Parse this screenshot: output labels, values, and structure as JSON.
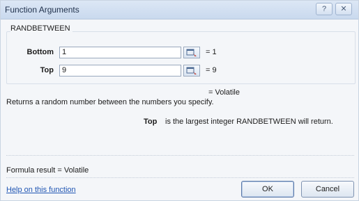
{
  "dialog": {
    "title": "Function Arguments",
    "help_button": "?",
    "close_button": "✕"
  },
  "function_name": "RANDBETWEEN",
  "arguments": [
    {
      "label": "Bottom",
      "value": "1",
      "result": "= 1"
    },
    {
      "label": "Top",
      "value": "9",
      "result": "= 9"
    }
  ],
  "function_result": "= Volatile",
  "description": "Returns a random number between the numbers you specify.",
  "argument_help": {
    "name": "Top",
    "text": "is the largest integer RANDBETWEEN will return."
  },
  "formula_result": "Formula result =   Volatile",
  "help_link": "Help on this function",
  "buttons": {
    "ok": "OK",
    "cancel": "Cancel"
  },
  "icons": {
    "collapse_dialog": "collapse-dialog-icon",
    "help": "help-icon",
    "close": "close-icon"
  }
}
